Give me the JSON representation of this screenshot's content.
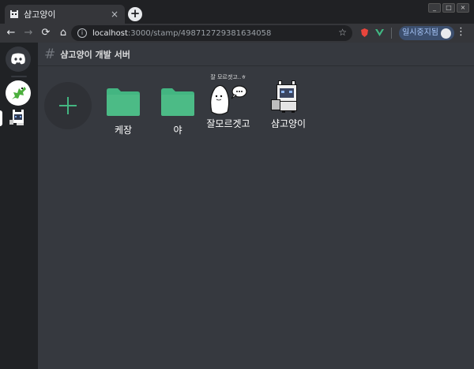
{
  "browser": {
    "tab_title": "샴고양이",
    "new_tab": "+",
    "tab_close": "×",
    "url_host": "localhost",
    "url_path": ":3000/stamp/498712729381634058",
    "paused_label": "일시중지됨",
    "back": "←",
    "forward": "→",
    "reload": "⟳",
    "home": "⌂",
    "bookmark": "☆",
    "menu": "⋮",
    "win_min": "_",
    "win_max": "□",
    "win_close": "×"
  },
  "channel": {
    "hash": "#",
    "name": "샴고양이 개발 서버"
  },
  "stamps": {
    "add_label": "+",
    "items": [
      {
        "label": "케장",
        "kind": "folder",
        "icon": "folder-icon"
      },
      {
        "label": "야",
        "kind": "folder",
        "icon": "folder-icon"
      },
      {
        "label": "잘모르겟고",
        "caption": "잘 모르겟고..ㅎ",
        "kind": "image",
        "icon": "ghost-sticker-icon"
      },
      {
        "label": "샴고양이",
        "kind": "image",
        "icon": "siamese-cat-icon"
      }
    ]
  },
  "colors": {
    "accent": "#43b581",
    "background": "#36393f",
    "sidebar": "#202225"
  }
}
